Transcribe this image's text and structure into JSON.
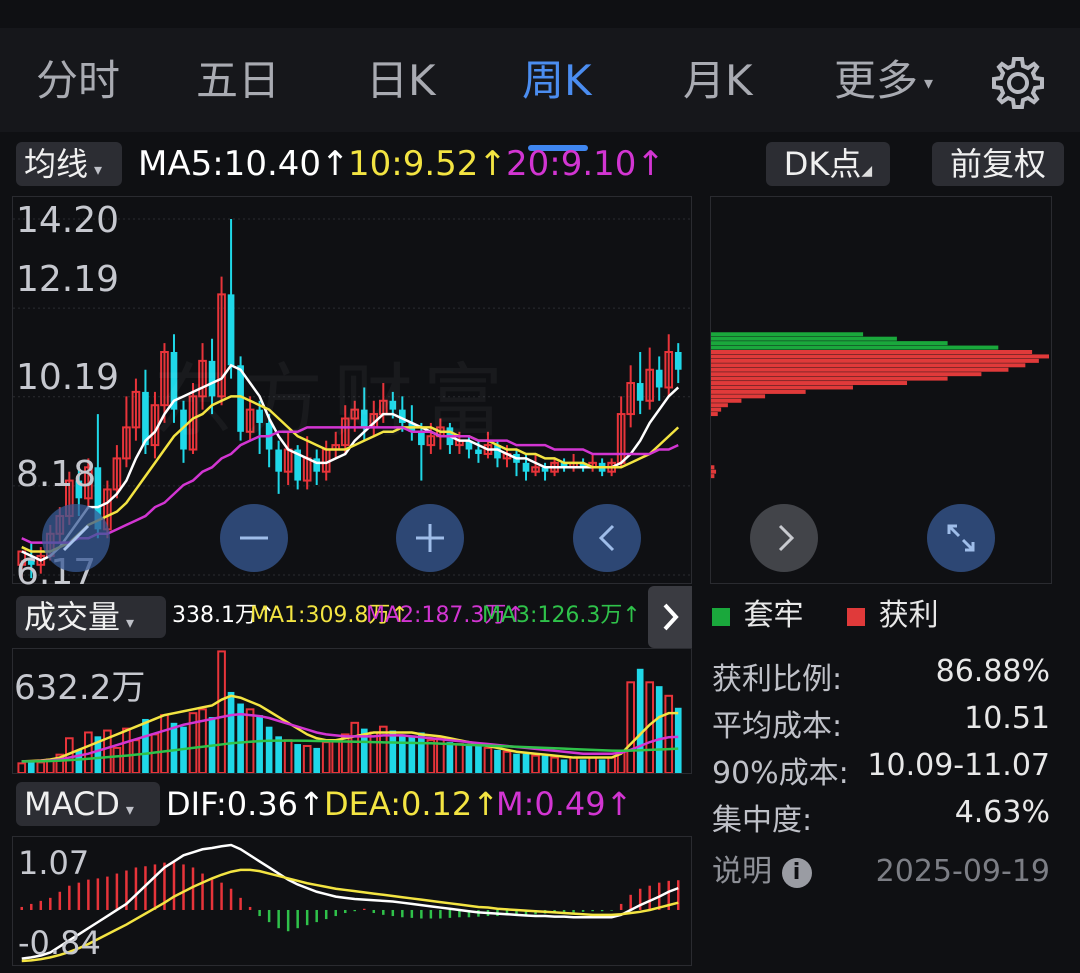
{
  "tabs": [
    {
      "label": "分时"
    },
    {
      "label": "五日"
    },
    {
      "label": "日K"
    },
    {
      "label": "周K"
    },
    {
      "label": "月K"
    },
    {
      "label": "更多"
    }
  ],
  "more_arrow": "▾",
  "active_tab_index": 3,
  "ma_bar": {
    "selector": "均线",
    "ma5": "MA5:10.40↑",
    "ma10": "10:9.52↑",
    "ma20": "20:9.10↑",
    "dk_label": "DK点",
    "fq_label": "前复权"
  },
  "price_axis": [
    "14.20",
    "12.19",
    "10.19",
    "8.18",
    "6.17"
  ],
  "watermark": "东方财富",
  "volume_bar": {
    "selector": "成交量",
    "value": "338.1万↑",
    "ma1": "MA1:309.8万↑",
    "ma2": "MA2:187.3万↑",
    "ma3": "MA3:126.3万↑",
    "axis_top": "632.2万"
  },
  "macd_bar": {
    "selector": "MACD",
    "dif": "DIF:0.36↑",
    "dea": "DEA:0.12↑",
    "m": "M:0.49↑",
    "axis_top": "1.07",
    "axis_bottom": "-0.84"
  },
  "chip": {
    "legend_trap": "套牢",
    "legend_profit": "获利",
    "rows": [
      {
        "label": "获利比例:",
        "value": "86.88%"
      },
      {
        "label": "平均成本:",
        "value": "10.51"
      },
      {
        "label": "90%成本:",
        "value": "10.09-11.07"
      },
      {
        "label": "集中度:",
        "value": "4.63%"
      }
    ],
    "note_label": "说明",
    "date": "2025-09-19"
  },
  "colors": {
    "up": "#e8343a",
    "down": "#1fd8e8",
    "ma5": "#ffffff",
    "ma10": "#f3e442",
    "ma20": "#d235d2",
    "accent": "#3f86f0",
    "trap": "#1aa83c",
    "profit": "#e03a3a"
  },
  "chart_data": [
    {
      "type": "candlestick",
      "title": "周K",
      "ylim": [
        6.17,
        14.2
      ],
      "y_ticks": [
        14.2,
        12.19,
        10.19,
        8.18,
        6.17
      ],
      "candles": [
        [
          6.4,
          6.7,
          6.1,
          6.5
        ],
        [
          6.5,
          6.4,
          6.1,
          6.9
        ],
        [
          6.4,
          6.6,
          6.2,
          6.8
        ],
        [
          6.6,
          7.1,
          6.5,
          7.3
        ],
        [
          7.1,
          7.5,
          6.9,
          7.7
        ],
        [
          7.5,
          8.3,
          7.3,
          8.5
        ],
        [
          8.3,
          7.9,
          7.5,
          8.6
        ],
        [
          7.9,
          8.6,
          7.7,
          8.8
        ],
        [
          8.6,
          7.2,
          7.0,
          9.8
        ],
        [
          7.2,
          8.1,
          7.0,
          8.3
        ],
        [
          8.1,
          8.8,
          7.9,
          9.1
        ],
        [
          8.8,
          9.5,
          8.6,
          10.2
        ],
        [
          9.5,
          10.3,
          9.2,
          10.6
        ],
        [
          10.3,
          9.1,
          8.9,
          10.8
        ],
        [
          9.1,
          10.0,
          8.8,
          10.3
        ],
        [
          10.0,
          11.2,
          9.6,
          11.4
        ],
        [
          11.2,
          9.9,
          9.6,
          11.6
        ],
        [
          9.9,
          9.0,
          8.7,
          10.1
        ],
        [
          9.0,
          10.2,
          8.9,
          10.5
        ],
        [
          10.2,
          11.0,
          9.9,
          11.4
        ],
        [
          11.0,
          10.2,
          9.8,
          11.5
        ],
        [
          10.2,
          12.5,
          10.0,
          12.9
        ],
        [
          12.5,
          10.9,
          10.6,
          14.2
        ],
        [
          10.9,
          9.4,
          9.2,
          11.1
        ],
        [
          9.4,
          9.9,
          9.2,
          10.2
        ],
        [
          9.9,
          9.6,
          8.9,
          10.1
        ],
        [
          9.6,
          9.0,
          8.6,
          9.8
        ],
        [
          9.0,
          8.5,
          8.0,
          9.2
        ],
        [
          8.5,
          9.0,
          8.2,
          9.4
        ],
        [
          9.0,
          8.3,
          8.1,
          9.1
        ],
        [
          8.3,
          8.8,
          8.1,
          9.3
        ],
        [
          8.8,
          8.5,
          8.2,
          9.0
        ],
        [
          8.5,
          9.0,
          8.3,
          9.2
        ],
        [
          9.0,
          9.1,
          8.8,
          9.4
        ],
        [
          9.1,
          9.7,
          8.9,
          10.0
        ],
        [
          9.7,
          9.9,
          9.4,
          10.1
        ],
        [
          9.9,
          9.5,
          9.2,
          10.4
        ],
        [
          9.5,
          9.8,
          9.3,
          10.1
        ],
        [
          9.8,
          10.1,
          9.6,
          10.5
        ],
        [
          10.1,
          9.9,
          9.7,
          10.3
        ],
        [
          9.9,
          9.6,
          9.4,
          10.2
        ],
        [
          9.6,
          9.4,
          9.2,
          10.0
        ],
        [
          9.4,
          9.1,
          8.3,
          9.6
        ],
        [
          9.1,
          9.3,
          8.9,
          9.6
        ],
        [
          9.3,
          9.5,
          9.0,
          9.7
        ],
        [
          9.5,
          9.1,
          8.9,
          9.6
        ],
        [
          9.1,
          9.2,
          8.9,
          9.4
        ],
        [
          9.2,
          9.0,
          8.8,
          9.3
        ],
        [
          9.0,
          8.9,
          8.7,
          9.2
        ],
        [
          8.9,
          9.1,
          8.8,
          9.4
        ],
        [
          9.1,
          8.8,
          8.6,
          9.2
        ],
        [
          8.8,
          8.9,
          8.6,
          9.1
        ],
        [
          8.9,
          8.7,
          8.4,
          9.0
        ],
        [
          8.7,
          8.5,
          8.3,
          8.9
        ],
        [
          8.5,
          8.6,
          8.4,
          8.9
        ],
        [
          8.6,
          8.5,
          8.3,
          8.7
        ],
        [
          8.5,
          8.7,
          8.4,
          8.8
        ],
        [
          8.7,
          8.6,
          8.5,
          8.8
        ],
        [
          8.6,
          8.7,
          8.5,
          8.9
        ],
        [
          8.7,
          8.6,
          8.5,
          8.8
        ],
        [
          8.6,
          8.7,
          8.5,
          8.9
        ],
        [
          8.7,
          8.5,
          8.4,
          8.8
        ],
        [
          8.5,
          8.7,
          8.4,
          8.8
        ],
        [
          8.7,
          9.8,
          8.6,
          10.2
        ],
        [
          9.8,
          10.5,
          9.5,
          10.9
        ],
        [
          10.5,
          10.1,
          9.8,
          11.2
        ],
        [
          10.1,
          10.8,
          9.9,
          11.3
        ],
        [
          10.8,
          10.4,
          10.1,
          11.1
        ],
        [
          10.4,
          11.2,
          10.2,
          11.6
        ],
        [
          11.2,
          10.8,
          10.5,
          11.4
        ]
      ],
      "ma5": [
        6.7,
        6.6,
        6.5,
        6.6,
        6.8,
        7.1,
        7.4,
        7.7,
        7.7,
        7.8,
        8.0,
        8.3,
        8.8,
        9.2,
        9.4,
        9.8,
        10.1,
        10.2,
        10.3,
        10.4,
        10.5,
        10.6,
        10.9,
        10.8,
        10.5,
        10.2,
        9.7,
        9.3,
        9.0,
        8.9,
        8.8,
        8.7,
        8.7,
        8.8,
        8.9,
        9.2,
        9.4,
        9.6,
        9.8,
        9.8,
        9.7,
        9.6,
        9.5,
        9.4,
        9.3,
        9.3,
        9.2,
        9.2,
        9.1,
        9.0,
        9.0,
        8.9,
        8.8,
        8.8,
        8.7,
        8.6,
        8.6,
        8.6,
        8.6,
        8.6,
        8.6,
        8.6,
        8.6,
        8.7,
        8.9,
        9.2,
        9.6,
        9.9,
        10.2,
        10.4
      ],
      "ma10": [
        6.8,
        6.7,
        6.7,
        6.7,
        6.8,
        6.9,
        7.1,
        7.3,
        7.4,
        7.5,
        7.6,
        7.8,
        8.1,
        8.4,
        8.7,
        9.0,
        9.3,
        9.5,
        9.7,
        9.8,
        10.0,
        10.1,
        10.2,
        10.2,
        10.1,
        10.0,
        9.9,
        9.7,
        9.5,
        9.3,
        9.2,
        9.1,
        9.0,
        9.0,
        9.0,
        9.1,
        9.2,
        9.3,
        9.4,
        9.4,
        9.5,
        9.5,
        9.5,
        9.5,
        9.4,
        9.4,
        9.3,
        9.3,
        9.2,
        9.2,
        9.1,
        9.0,
        9.0,
        8.9,
        8.9,
        8.8,
        8.8,
        8.7,
        8.7,
        8.7,
        8.6,
        8.6,
        8.6,
        8.6,
        8.7,
        8.8,
        8.9,
        9.1,
        9.3,
        9.5
      ],
      "ma20": [
        7.0,
        6.9,
        6.9,
        6.9,
        6.9,
        6.9,
        7.0,
        7.0,
        7.1,
        7.1,
        7.2,
        7.3,
        7.4,
        7.5,
        7.7,
        7.8,
        8.0,
        8.2,
        8.3,
        8.5,
        8.6,
        8.8,
        8.9,
        9.1,
        9.2,
        9.3,
        9.3,
        9.4,
        9.4,
        9.4,
        9.5,
        9.5,
        9.5,
        9.5,
        9.5,
        9.5,
        9.5,
        9.5,
        9.5,
        9.5,
        9.5,
        9.4,
        9.4,
        9.4,
        9.3,
        9.3,
        9.3,
        9.3,
        9.2,
        9.2,
        9.2,
        9.2,
        9.1,
        9.1,
        9.1,
        9.1,
        9.0,
        9.0,
        9.0,
        9.0,
        8.9,
        8.9,
        8.9,
        8.9,
        8.9,
        8.9,
        8.9,
        9.0,
        9.0,
        9.1
      ]
    },
    {
      "type": "bar",
      "title": "成交量",
      "ylim": [
        0,
        632.2
      ],
      "y_ticks": [
        632.2
      ],
      "values": [
        50,
        60,
        55,
        70,
        95,
        180,
        120,
        210,
        190,
        220,
        130,
        230,
        170,
        280,
        200,
        300,
        260,
        240,
        310,
        330,
        290,
        630,
        420,
        360,
        330,
        300,
        240,
        190,
        170,
        150,
        140,
        130,
        160,
        170,
        200,
        260,
        230,
        210,
        240,
        220,
        200,
        190,
        210,
        170,
        180,
        160,
        150,
        140,
        150,
        130,
        120,
        110,
        100,
        100,
        90,
        90,
        80,
        70,
        80,
        70,
        80,
        70,
        80,
        110,
        470,
        540,
        470,
        450,
        400,
        338
      ],
      "ma1": [
        60,
        62,
        65,
        70,
        80,
        100,
        120,
        140,
        160,
        180,
        200,
        220,
        240,
        260,
        280,
        300,
        310,
        320,
        330,
        340,
        350,
        380,
        400,
        390,
        370,
        350,
        320,
        290,
        260,
        230,
        200,
        180,
        170,
        170,
        180,
        190,
        200,
        210,
        210,
        210,
        210,
        210,
        200,
        195,
        190,
        180,
        170,
        160,
        150,
        140,
        130,
        120,
        110,
        105,
        100,
        95,
        90,
        85,
        80,
        80,
        80,
        80,
        80,
        100,
        150,
        200,
        250,
        290,
        310,
        310
      ],
      "ma2": [
        60,
        60,
        62,
        65,
        70,
        80,
        90,
        100,
        115,
        130,
        145,
        160,
        175,
        190,
        205,
        220,
        235,
        250,
        260,
        270,
        280,
        290,
        300,
        305,
        300,
        295,
        285,
        270,
        255,
        240,
        225,
        210,
        200,
        195,
        190,
        190,
        190,
        190,
        195,
        195,
        195,
        190,
        185,
        180,
        175,
        170,
        165,
        160,
        155,
        150,
        145,
        140,
        135,
        130,
        125,
        120,
        115,
        110,
        105,
        100,
        100,
        100,
        100,
        105,
        120,
        140,
        160,
        175,
        185,
        187
      ],
      "ma3": [
        60,
        60,
        61,
        62,
        64,
        67,
        70,
        74,
        78,
        82,
        86,
        90,
        95,
        100,
        106,
        112,
        118,
        124,
        130,
        136,
        142,
        148,
        154,
        158,
        162,
        165,
        167,
        168,
        168,
        168,
        167,
        166,
        165,
        164,
        163,
        162,
        161,
        160,
        159,
        158,
        157,
        156,
        155,
        154,
        152,
        150,
        148,
        146,
        144,
        142,
        140,
        138,
        136,
        134,
        132,
        130,
        128,
        126,
        124,
        122,
        120,
        118,
        116,
        115,
        116,
        118,
        120,
        122,
        124,
        126
      ]
    },
    {
      "type": "bar",
      "title": "MACD",
      "ylim": [
        -0.84,
        1.07
      ],
      "y_ticks": [
        1.07,
        -0.84
      ],
      "values": [
        0.05,
        0.1,
        0.15,
        0.2,
        0.3,
        0.4,
        0.45,
        0.5,
        0.52,
        0.55,
        0.6,
        0.65,
        0.7,
        0.72,
        0.75,
        0.78,
        0.8,
        0.75,
        0.7,
        0.6,
        0.5,
        0.45,
        0.35,
        0.2,
        0.05,
        -0.1,
        -0.2,
        -0.3,
        -0.35,
        -0.3,
        -0.25,
        -0.2,
        -0.15,
        -0.1,
        -0.05,
        -0.02,
        0.02,
        -0.05,
        -0.08,
        -0.1,
        -0.12,
        -0.13,
        -0.14,
        -0.14,
        -0.14,
        -0.13,
        -0.12,
        -0.12,
        -0.11,
        -0.1,
        -0.1,
        -0.09,
        -0.08,
        -0.08,
        -0.07,
        -0.06,
        -0.05,
        -0.04,
        -0.04,
        -0.03,
        -0.02,
        -0.02,
        -0.01,
        0.1,
        0.25,
        0.35,
        0.4,
        0.45,
        0.48,
        0.49
      ],
      "dif": [
        -0.8,
        -0.78,
        -0.75,
        -0.7,
        -0.6,
        -0.5,
        -0.4,
        -0.3,
        -0.2,
        -0.1,
        0.0,
        0.1,
        0.25,
        0.4,
        0.55,
        0.7,
        0.8,
        0.9,
        0.95,
        1.0,
        1.02,
        1.05,
        1.07,
        1.0,
        0.9,
        0.8,
        0.7,
        0.6,
        0.5,
        0.42,
        0.36,
        0.3,
        0.26,
        0.22,
        0.2,
        0.18,
        0.17,
        0.16,
        0.15,
        0.14,
        0.12,
        0.1,
        0.08,
        0.06,
        0.04,
        0.02,
        0.0,
        -0.02,
        -0.04,
        -0.05,
        -0.06,
        -0.07,
        -0.08,
        -0.09,
        -0.1,
        -0.1,
        -0.11,
        -0.11,
        -0.12,
        -0.12,
        -0.12,
        -0.12,
        -0.12,
        -0.08,
        0.0,
        0.08,
        0.15,
        0.22,
        0.3,
        0.36
      ],
      "dea": [
        -0.84,
        -0.83,
        -0.81,
        -0.78,
        -0.74,
        -0.69,
        -0.63,
        -0.56,
        -0.48,
        -0.4,
        -0.32,
        -0.24,
        -0.15,
        -0.06,
        0.03,
        0.12,
        0.22,
        0.3,
        0.38,
        0.45,
        0.52,
        0.58,
        0.63,
        0.66,
        0.66,
        0.64,
        0.6,
        0.56,
        0.52,
        0.48,
        0.44,
        0.41,
        0.38,
        0.35,
        0.33,
        0.31,
        0.29,
        0.27,
        0.25,
        0.23,
        0.21,
        0.19,
        0.17,
        0.15,
        0.13,
        0.11,
        0.09,
        0.07,
        0.05,
        0.04,
        0.02,
        0.01,
        0.0,
        -0.01,
        -0.02,
        -0.03,
        -0.04,
        -0.05,
        -0.06,
        -0.07,
        -0.08,
        -0.08,
        -0.08,
        -0.07,
        -0.05,
        -0.03,
        0.0,
        0.04,
        0.08,
        0.12
      ]
    },
    {
      "type": "bar",
      "title": "筹码分布",
      "ylim": [
        6.17,
        14.2
      ],
      "bars": [
        {
          "price": 11.6,
          "value": 0.45,
          "group": "trap"
        },
        {
          "price": 11.5,
          "value": 0.55,
          "group": "trap"
        },
        {
          "price": 11.4,
          "value": 0.7,
          "group": "trap"
        },
        {
          "price": 11.3,
          "value": 0.85,
          "group": "trap"
        },
        {
          "price": 11.2,
          "value": 0.95,
          "group": "profit"
        },
        {
          "price": 11.1,
          "value": 1.0,
          "group": "profit"
        },
        {
          "price": 11.0,
          "value": 0.97,
          "group": "profit"
        },
        {
          "price": 10.9,
          "value": 0.93,
          "group": "profit"
        },
        {
          "price": 10.8,
          "value": 0.88,
          "group": "profit"
        },
        {
          "price": 10.7,
          "value": 0.8,
          "group": "profit"
        },
        {
          "price": 10.6,
          "value": 0.7,
          "group": "profit"
        },
        {
          "price": 10.5,
          "value": 0.58,
          "group": "profit"
        },
        {
          "price": 10.4,
          "value": 0.42,
          "group": "profit"
        },
        {
          "price": 10.3,
          "value": 0.28,
          "group": "profit"
        },
        {
          "price": 10.2,
          "value": 0.16,
          "group": "profit"
        },
        {
          "price": 10.1,
          "value": 0.09,
          "group": "profit"
        },
        {
          "price": 10.0,
          "value": 0.05,
          "group": "profit"
        },
        {
          "price": 9.9,
          "value": 0.03,
          "group": "profit"
        },
        {
          "price": 9.8,
          "value": 0.02,
          "group": "profit"
        },
        {
          "price": 8.6,
          "value": 0.01,
          "group": "profit"
        },
        {
          "price": 8.5,
          "value": 0.015,
          "group": "profit"
        },
        {
          "price": 8.4,
          "value": 0.01,
          "group": "profit"
        }
      ]
    }
  ]
}
